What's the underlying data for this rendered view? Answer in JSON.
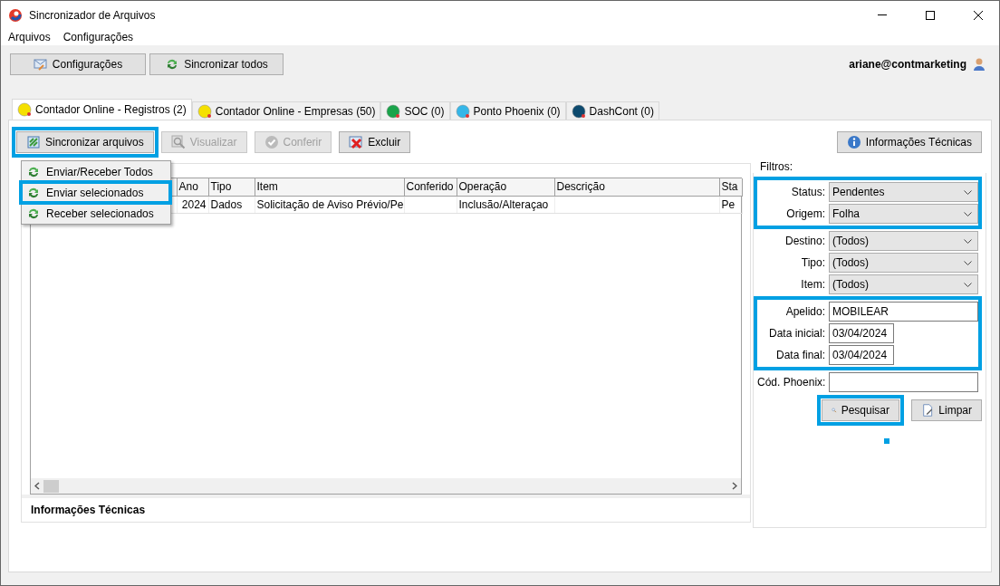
{
  "window": {
    "title": "Sincronizador de Arquivos"
  },
  "menu_bar": [
    "Arquivos",
    "Configurações"
  ],
  "toolbar": [
    {
      "label": "Configurações"
    },
    {
      "label": "Sincronizar todos"
    }
  ],
  "user": "ariane@contmarketing",
  "tabs": [
    {
      "label": "Contador Online - Registros (2)",
      "selected": true
    },
    {
      "label": "Contador Online - Empresas (50)",
      "selected": false
    },
    {
      "label": "SOC (0)",
      "selected": false
    },
    {
      "label": "Ponto Phoenix (0)",
      "selected": false
    },
    {
      "label": "DashCont (0)",
      "selected": false
    }
  ],
  "actions": [
    {
      "label": "Sincronizar arquivos",
      "disabled": false,
      "highlighted": true
    },
    {
      "label": "Visualizar",
      "disabled": true,
      "highlighted": false
    },
    {
      "label": "Conferir",
      "disabled": true,
      "highlighted": false
    },
    {
      "label": "Excluir",
      "disabled": false,
      "highlighted": false
    }
  ],
  "info_button": "Informações Técnicas",
  "sync_menu": [
    {
      "label": "Enviar/Receber Todos",
      "highlighted": false
    },
    {
      "label": "Enviar selecionados",
      "highlighted": true
    },
    {
      "label": "Receber selecionados",
      "highlighted": false
    }
  ],
  "table": {
    "columns": [
      "Ano",
      "Tipo",
      "Item",
      "Conferido",
      "Operação",
      "Descrição",
      "Sta"
    ],
    "rows": [
      [
        "2024",
        "Dados",
        "Solicitação de Aviso Prévio/Pe",
        "",
        "Inclusão/Alteraçao",
        "",
        "Pe"
      ]
    ]
  },
  "info_section": "Informações Técnicas",
  "filters": {
    "title": "Filtros:",
    "groups": [
      {
        "highlighted": true,
        "rows": [
          {
            "label": "Status:",
            "kind": "dropdown",
            "value": "Pendentes"
          },
          {
            "label": "Origem:",
            "kind": "dropdown",
            "value": "Folha"
          }
        ]
      },
      {
        "highlighted": false,
        "rows": [
          {
            "label": "Destino:",
            "kind": "dropdown",
            "value": "(Todos)"
          },
          {
            "label": "Tipo:",
            "kind": "dropdown",
            "value": "(Todos)"
          },
          {
            "label": "Item:",
            "kind": "dropdown",
            "value": "(Todos)"
          }
        ]
      },
      {
        "highlighted": true,
        "rows": [
          {
            "label": "Apelido:",
            "kind": "text",
            "value": "MOBILEAR"
          },
          {
            "label": "Data inicial:",
            "kind": "date",
            "value": "03/04/2024"
          },
          {
            "label": "Data final:",
            "kind": "date",
            "value": "03/04/2024"
          }
        ]
      },
      {
        "highlighted": false,
        "rows": [
          {
            "label": "Cód. Phoenix:",
            "kind": "text",
            "value": ""
          }
        ]
      }
    ],
    "buttons": [
      {
        "label": "Pesquisar",
        "highlighted": true
      },
      {
        "label": "Limpar",
        "highlighted": false
      }
    ]
  }
}
